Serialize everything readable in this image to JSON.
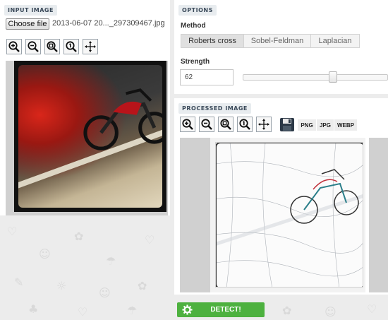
{
  "input": {
    "section_title": "INPUT IMAGE",
    "choose_file_label": "Choose file",
    "file_name": "2013-06-07 20..._297309467.jpg"
  },
  "options": {
    "section_title": "OPTIONS",
    "method_label": "Method",
    "methods": [
      "Roberts cross",
      "Sobel-Feldman",
      "Laplacian"
    ],
    "selected_method": "Roberts cross",
    "strength_label": "Strength",
    "strength_value": "62",
    "strength_fraction": 0.62
  },
  "processed": {
    "section_title": "PROCESSED IMAGE",
    "formats": [
      "PNG",
      "JPG",
      "WEBP"
    ]
  },
  "tools": {
    "icons": [
      "zoom-in-icon",
      "zoom-out-icon",
      "zoom-fit-icon",
      "zoom-actual-icon",
      "move-icon",
      "save-icon"
    ]
  },
  "detect": {
    "label": "DETECT!",
    "color": "#4db13f"
  },
  "colors": {
    "background": "#ececec",
    "panel": "#ffffff",
    "tag_text": "#3b4a5a"
  }
}
